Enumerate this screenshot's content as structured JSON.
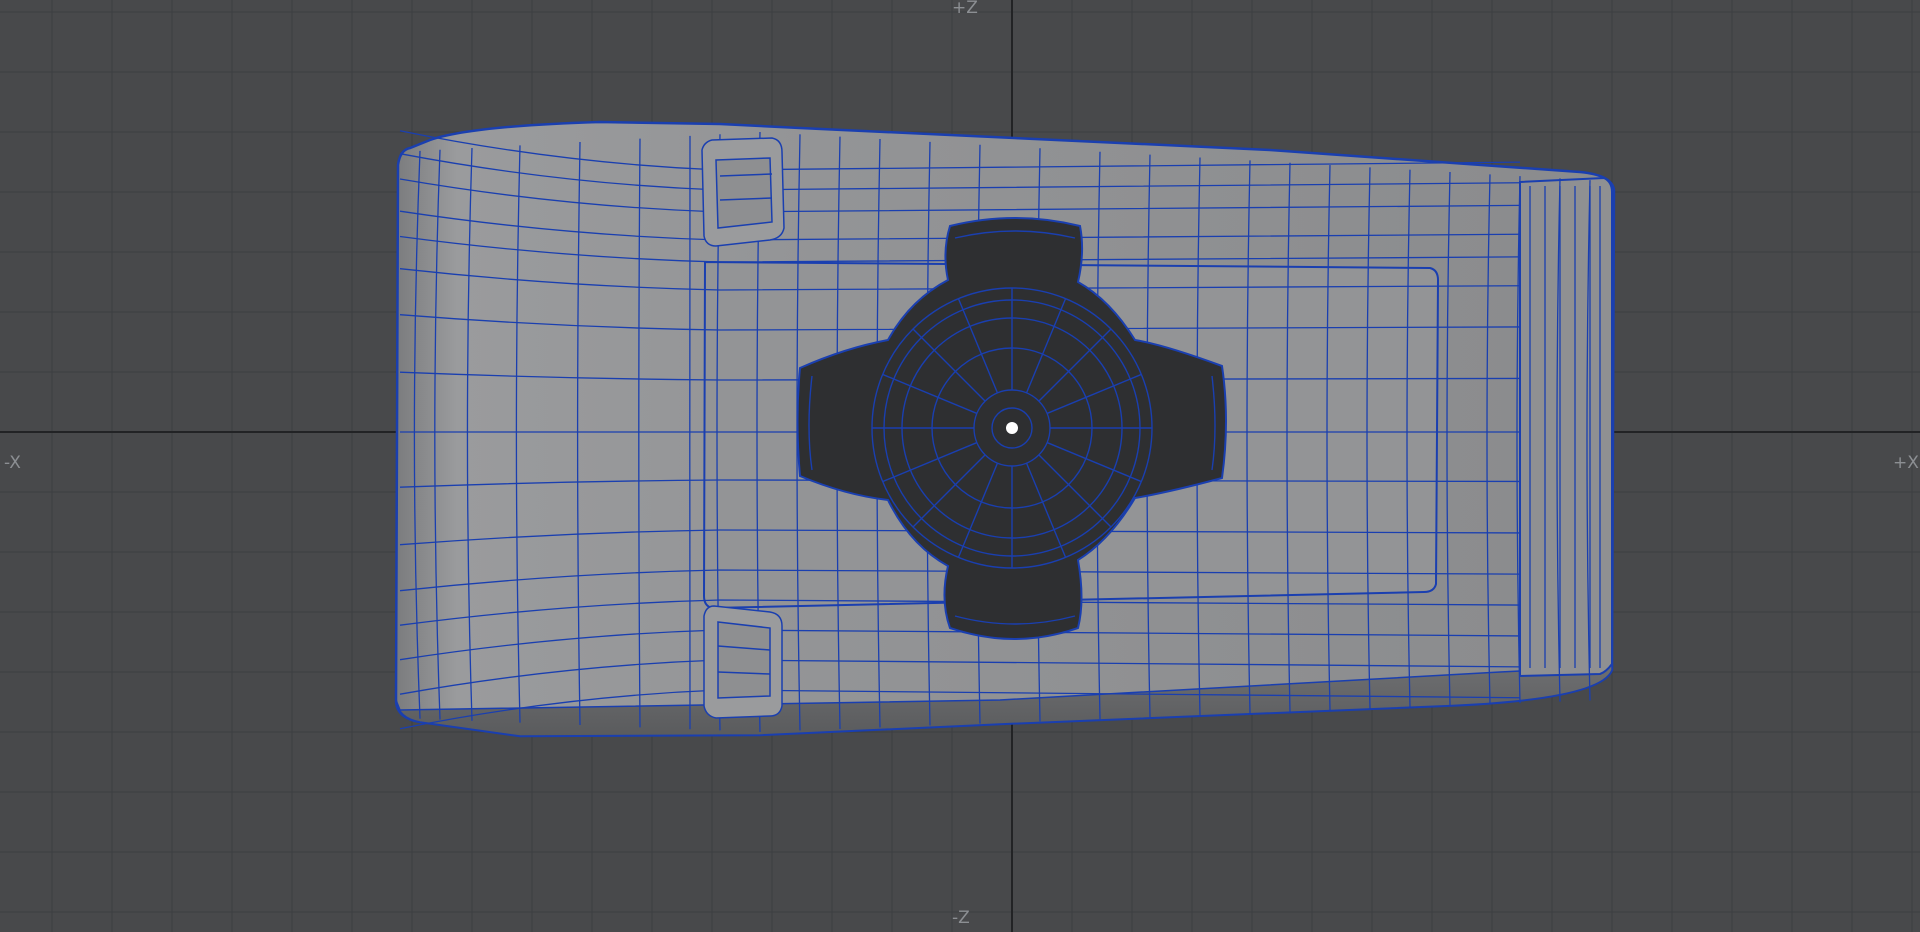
{
  "viewport": {
    "view": "top",
    "background_color": "#48494b",
    "grid_color": "#3b3d40",
    "axis_color": "#1f2022",
    "wire_color": "#1a3fb0",
    "mesh_fill_color": "#8e8f91",
    "knob_fill_color": "#2e2f31"
  },
  "axes": {
    "pos_z": "+Z",
    "neg_z": "-Z",
    "neg_x": "-X",
    "pos_x": "+X"
  }
}
